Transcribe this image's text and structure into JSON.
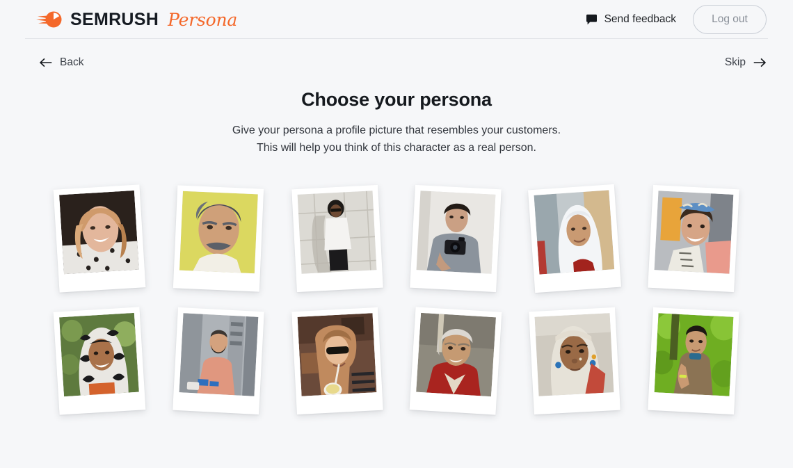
{
  "header": {
    "brand_name": "SEMRUSH",
    "brand_sub": "Persona",
    "logo_icon": "semrush-comet-icon",
    "feedback_label": "Send feedback",
    "feedback_icon": "speech-bubble-icon",
    "logout_label": "Log out"
  },
  "nav": {
    "back_label": "Back",
    "back_icon": "arrow-left-icon",
    "skip_label": "Skip",
    "skip_icon": "arrow-right-icon"
  },
  "hero": {
    "title": "Choose your persona",
    "subtitle_line1": "Give your persona a profile picture that resembles your customers.",
    "subtitle_line2": "This will help you think of this character as a real person."
  },
  "colors": {
    "page_background": "#f6f7f9",
    "brand_orange": "#f4682a",
    "text_primary": "#15191e",
    "text_muted": "#8a9099",
    "divider": "#e1e3e8",
    "card_white": "#ffffff"
  },
  "personas": [
    {
      "id": "persona-1",
      "alt": "Smiling blonde woman in polka dot top",
      "rotate": -3.5
    },
    {
      "id": "persona-2",
      "alt": "Older man with mustache on yellow background",
      "rotate": 2.5
    },
    {
      "id": "persona-3",
      "alt": "Young man with afro and sunglasses against tiled wall",
      "rotate": -3
    },
    {
      "id": "persona-4",
      "alt": "Young man holding a camera",
      "rotate": 3
    },
    {
      "id": "persona-5",
      "alt": "Young woman wearing a white hijab",
      "rotate": -4
    },
    {
      "id": "persona-6",
      "alt": "Laughing woman with patterned headscarf",
      "rotate": 3
    },
    {
      "id": "persona-7",
      "alt": "Smiling woman in black and white patterned scarf",
      "rotate": -3.5
    },
    {
      "id": "persona-8",
      "alt": "Bearded man in pink shirt on a city street",
      "rotate": 3
    },
    {
      "id": "persona-9",
      "alt": "Woman in sunglasses drinking through a straw",
      "rotate": -3
    },
    {
      "id": "persona-10",
      "alt": "Elderly woman in red jacket smiling",
      "rotate": 3.5
    },
    {
      "id": "persona-11",
      "alt": "Woman with white head wrap and blue earrings",
      "rotate": -3
    },
    {
      "id": "persona-12",
      "alt": "Young person in brown shirt among green foliage",
      "rotate": 3
    }
  ]
}
